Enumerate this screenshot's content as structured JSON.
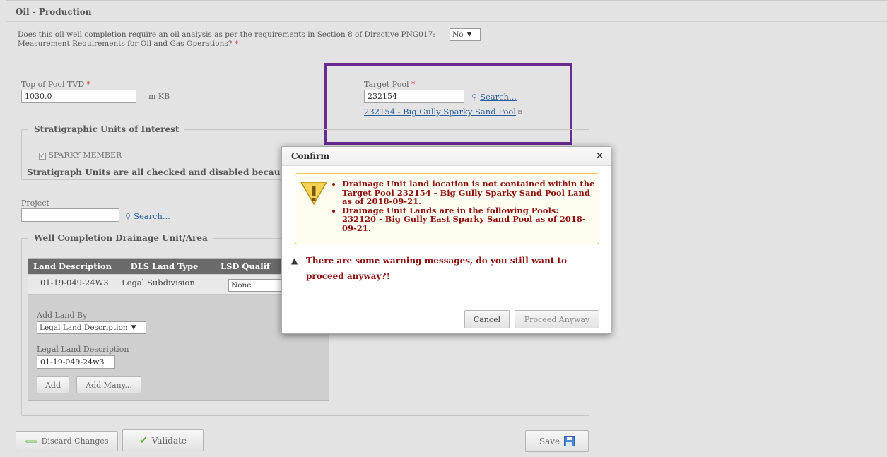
{
  "section": {
    "title": "Oil - Production"
  },
  "question": {
    "text": "Does this oil well completion require an oil analysis as per the requirements in Section 8 of Directive PNG017: Measurement Requirements for Oil and Gas Operations?",
    "required_mark": "*",
    "answer": "No"
  },
  "top_of_pool": {
    "label": "Top of Pool TVD",
    "required_mark": "*",
    "value": "1030.0",
    "unit": "m KB"
  },
  "target_pool": {
    "label": "Target Pool",
    "required_mark": "*",
    "value": "232154",
    "search_label": "Search...",
    "link_text": "232154 - Big Gully Sparky Sand Pool"
  },
  "strat": {
    "legend": "Stratigraphic Units of Interest",
    "checkbox_label": "SPARKY MEMBER",
    "note": "Stratigraph Units are all checked and disabled because"
  },
  "project": {
    "label": "Project",
    "value": "",
    "search_label": "Search..."
  },
  "drainage": {
    "legend": "Well Completion Drainage Unit/Area",
    "columns": [
      "Land Description",
      "DLS Land Type",
      "LSD Qualif"
    ],
    "rows": [
      {
        "land": "01-19-049-24W3",
        "type": "Legal Subdivision",
        "qualifier": "None"
      }
    ],
    "add_land_by_label": "Add Land By",
    "add_land_by_value": "Legal Land Description",
    "lld_label": "Legal Land Description",
    "lld_value": "01-19-049-24w3",
    "add_label": "Add",
    "add_many_label": "Add Many..."
  },
  "footer": {
    "discard_label": "Discard Changes",
    "validate_label": "Validate",
    "save_label": "Save"
  },
  "modal": {
    "title": "Confirm",
    "close": "×",
    "warnings": [
      "Drainage Unit land location is not contained within the Target Pool 232154 - Big Gully Sparky Sand Pool Land as of 2018-09-21.",
      "Drainage Unit Lands are in the following Pools: 232120 - Big Gully East Sparky Sand Pool as of 2018-09-21."
    ],
    "question": "There are some warning messages, do you still want to proceed anyway?!",
    "cancel_label": "Cancel",
    "proceed_label": "Proceed Anyway"
  },
  "colors": {
    "highlight_box": "#6a2c91",
    "warning_text": "#8e1111",
    "link": "#2a5d9a"
  }
}
